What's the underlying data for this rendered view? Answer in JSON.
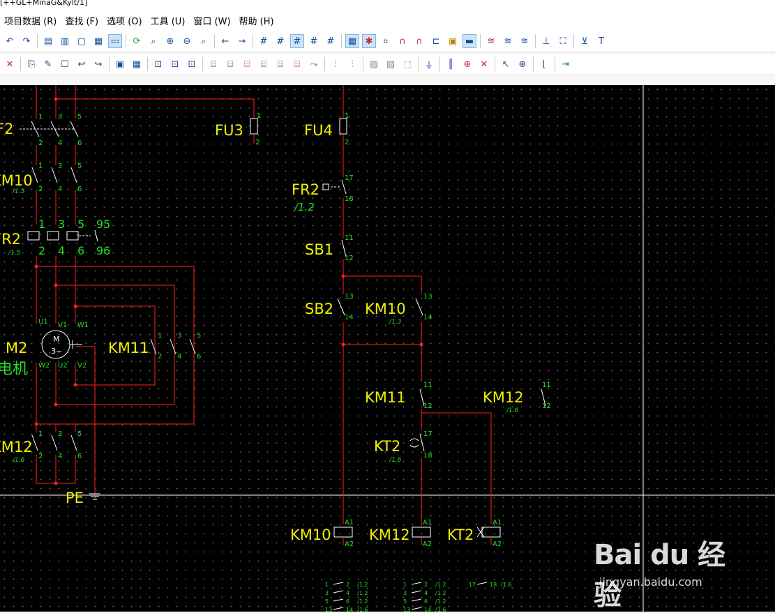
{
  "window": {
    "title": "[++GL+MinaG&Kylt/1]"
  },
  "menu": [
    "项目数据 (R)",
    "查找 (F)",
    "选项 (O)",
    "工具 (U)",
    "窗口 (W)",
    "帮助 (H)"
  ],
  "toolbar1_icons": [
    "undo-icon",
    "redo-icon",
    "page-icon",
    "page-gray-icon",
    "doc-check-icon",
    "table-icon",
    "monitor-icon",
    "refresh-icon",
    "zoom-fit-icon",
    "zoom-in-icon",
    "zoom-out-icon",
    "zoom-100-icon",
    "arrow-left-icon",
    "arrow-right-icon",
    "grid-a-icon",
    "grid-b-icon",
    "grid-c-icon",
    "grid-d-icon",
    "grid-e-icon",
    "grid-on-icon",
    "grid-snap-icon",
    "hash-icon",
    "magnet-icon",
    "magnet-double-icon",
    "connect-icon",
    "image-icon",
    "layer-icon",
    "format-a-icon",
    "format-b-icon",
    "format-c-icon",
    "pin-icon",
    "frame-select-icon",
    "cart-icon",
    "text-insert-icon"
  ],
  "toolbar2_icons": [
    "delete-icon",
    "copy-icon",
    "new-icon",
    "properties-icon",
    "reverse-icon",
    "export-icon",
    "device-icon",
    "table-edit-icon",
    "select-a-icon",
    "select-b-icon",
    "select-c-icon",
    "wire-a-icon",
    "wire-b-icon",
    "wire-c-icon",
    "wire-d-icon",
    "wire-e-icon",
    "wire-f-icon",
    "wire-g-icon",
    "terminal-a-icon",
    "terminal-b-icon",
    "hatch-a-icon",
    "hatch-b-icon",
    "hatch-c-icon",
    "cable-icon",
    "bus-a-icon",
    "bus-b-icon",
    "bus-c-icon",
    "pointer-icon",
    "cross-icon",
    "corner-icon",
    "arrow-line-icon"
  ],
  "schematic": {
    "labels": {
      "F2": "F2",
      "FU3": "FU3",
      "FU4": "FU4",
      "KM10": "KM10",
      "FR2": "FR2",
      "M2": "M2",
      "motor_sub": "电机",
      "KM11": "KM11",
      "KM12": "KM12",
      "PE": "PE",
      "SB1": "SB1",
      "SB2": "SB2",
      "KT2": "KT2",
      "motor_M": "M",
      "motor_3": "3~"
    },
    "refs": {
      "r15": "/1.5",
      "r16": "/1.6",
      "r12": "/1.2",
      "r13": "/1.3"
    },
    "pins": {
      "n1": "1",
      "n2": "2",
      "n3": "3",
      "n4": "4",
      "n5": "5",
      "n6": "6",
      "n11": "11",
      "n12": "12",
      "n13": "13",
      "n14": "14",
      "n17": "17",
      "n18": "18",
      "n95": "95",
      "n96": "96",
      "A1": "A1",
      "A2": "A2",
      "U1": "U1",
      "V1": "V1",
      "W1": "W1",
      "U2": "U2",
      "V2": "V2",
      "W2": "W2"
    },
    "xref_tables": [
      [
        "1",
        "2",
        "/1.2",
        "3",
        "4",
        "/1.2",
        "5",
        "6",
        "/1.2",
        "13",
        "14",
        "/1.6"
      ],
      [
        "1",
        "2",
        "/1.2",
        "3",
        "4",
        "/1.2",
        "5",
        "6",
        "/1.2",
        "13",
        "14",
        "/1.6"
      ],
      [
        "17",
        "18",
        "/1.6"
      ]
    ]
  },
  "watermark": {
    "logo": "Bai  du 经验",
    "url": "jingyan.baidu.com"
  },
  "colors": {
    "canvas_bg": "#000000",
    "wire": "#ff2020",
    "label": "#f0f000",
    "pin": "#22e022",
    "symbol": "#ffffff",
    "crosshair": "#ffffff"
  }
}
